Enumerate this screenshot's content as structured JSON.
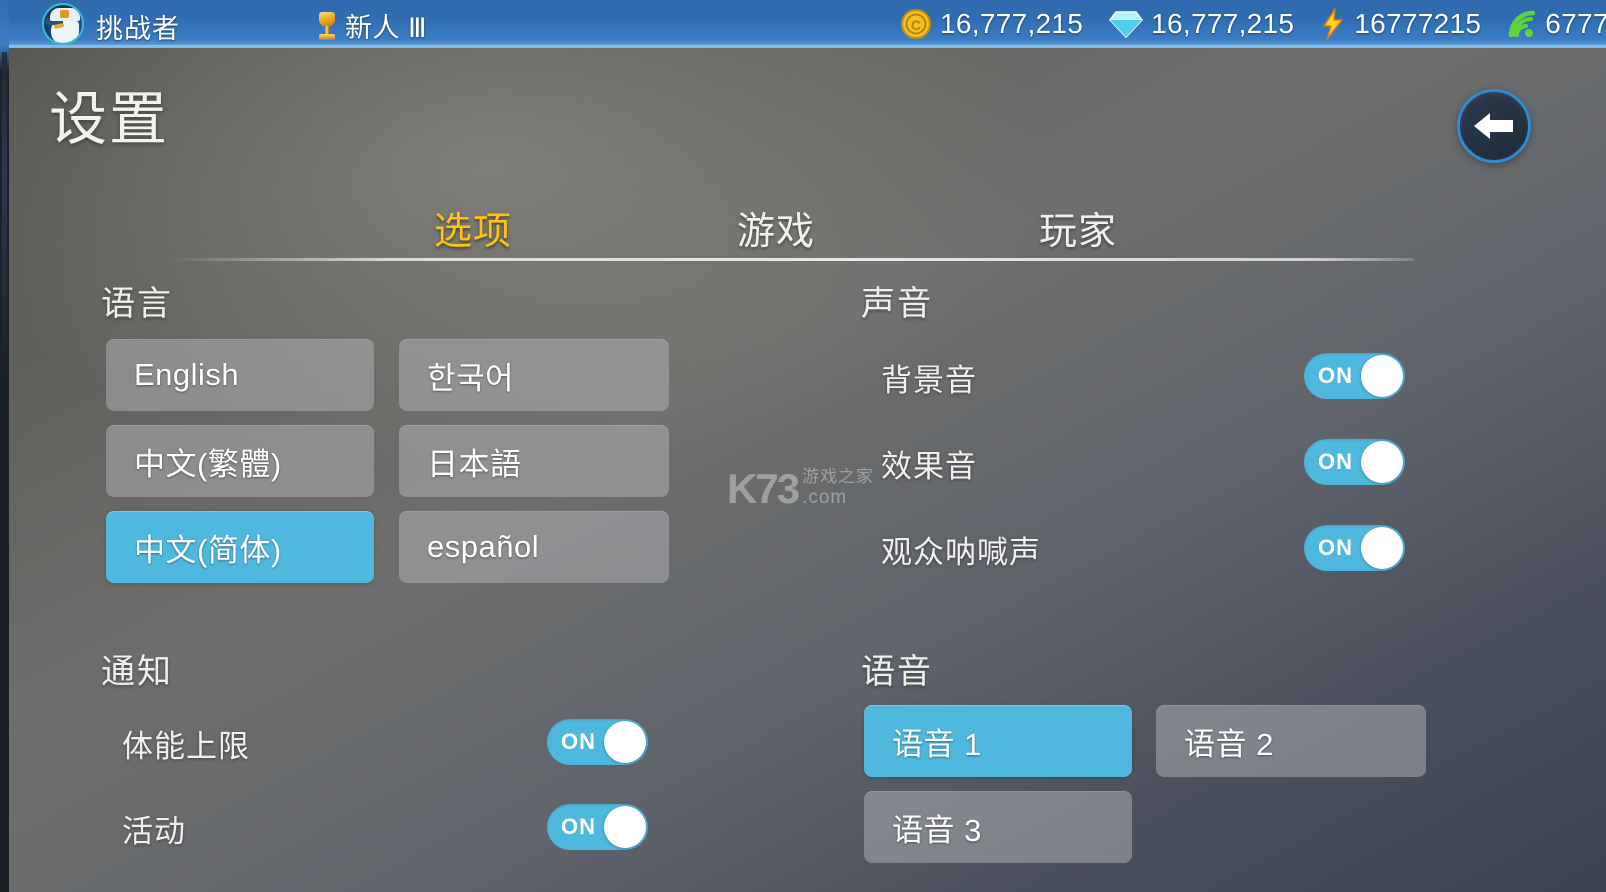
{
  "topbar": {
    "player_name": "挑战者",
    "rank_label": "新人 Ⅲ",
    "avatar_icon": "wolf-avatar-icon",
    "trophy_icon": "trophy-icon",
    "currencies": [
      {
        "icon": "coin-icon",
        "value": "16,777,215"
      },
      {
        "icon": "gem-icon",
        "value": "16,777,215"
      },
      {
        "icon": "lightning-icon",
        "value": "16777215"
      },
      {
        "icon": "signal-icon",
        "value": "6777"
      }
    ]
  },
  "header": {
    "title": "设置",
    "back_icon": "back-arrow-icon"
  },
  "tabs": [
    {
      "label": "选项",
      "active": true
    },
    {
      "label": "游戏",
      "active": false
    },
    {
      "label": "玩家",
      "active": false
    }
  ],
  "sections": {
    "language": {
      "title": "语言",
      "options": [
        {
          "label": "English",
          "selected": false
        },
        {
          "label": "한국어",
          "selected": false
        },
        {
          "label": "中文(繁體)",
          "selected": false
        },
        {
          "label": "日本語",
          "selected": false
        },
        {
          "label": "中文(简体)",
          "selected": true
        },
        {
          "label": "español",
          "selected": false
        }
      ]
    },
    "sound": {
      "title": "声音",
      "rows": [
        {
          "label": "背景音",
          "state": "ON"
        },
        {
          "label": "效果音",
          "state": "ON"
        },
        {
          "label": "观众呐喊声",
          "state": "ON"
        }
      ]
    },
    "notification": {
      "title": "通知",
      "rows": [
        {
          "label": "体能上限",
          "state": "ON"
        },
        {
          "label": "活动",
          "state": "ON"
        }
      ]
    },
    "voice": {
      "title": "语音",
      "options": [
        {
          "label": "语音 1",
          "selected": true
        },
        {
          "label": "语音 2",
          "selected": false
        },
        {
          "label": "语音 3",
          "selected": false
        }
      ]
    }
  },
  "watermark": {
    "logo": "K73",
    "cn": "游戏之家",
    "domain": ".com"
  },
  "colors": {
    "accent_blue": "#4fb8de",
    "tab_active_gold": "#ffc114",
    "topbar_blue": "#2f6cb1",
    "back_border": "#2e8bd0"
  }
}
